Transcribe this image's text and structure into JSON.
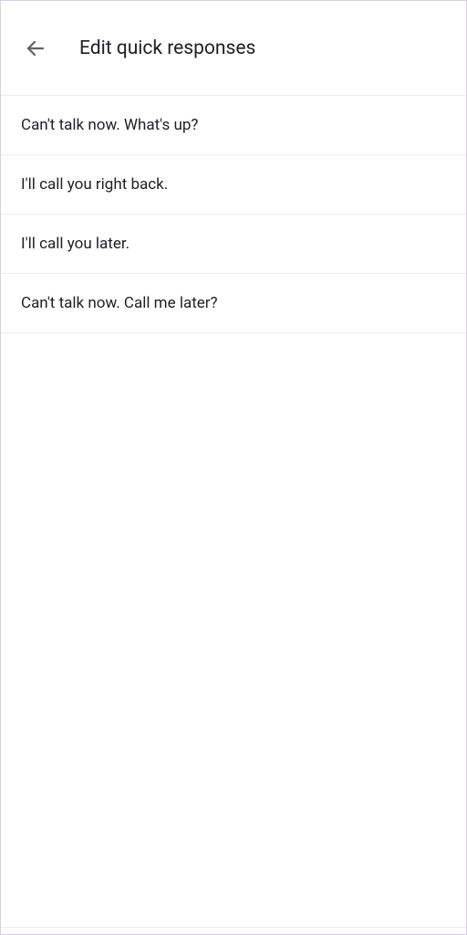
{
  "header": {
    "title": "Edit quick responses"
  },
  "responses": [
    "Can't talk now. What's up?",
    "I'll call you right back.",
    "I'll call you later.",
    "Can't talk now. Call me later?"
  ]
}
